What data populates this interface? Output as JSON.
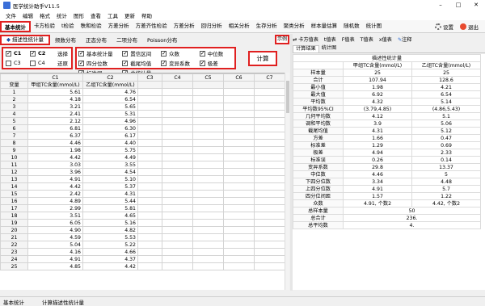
{
  "app": {
    "title": "医学统计助手V11.5"
  },
  "menu": [
    "文件",
    "编辑",
    "格式",
    "统计",
    "图形",
    "查看",
    "工具",
    "更新",
    "帮助"
  ],
  "ribbon": {
    "tabs": [
      "基本统计",
      "卡方检验",
      "t检验",
      "秩和检验",
      "方差分析",
      "方差齐性检验",
      "方差分析",
      "回归分析",
      "相关分析",
      "生存分析",
      "聚类分析",
      "样本量估算",
      "随机数",
      "统计图"
    ],
    "settings": "设置",
    "exit": "退出"
  },
  "subtabs": [
    "描述性统计量",
    "频数分布",
    "正态分布",
    "二项分布",
    "Poisson分布"
  ],
  "sample_label": "示例",
  "select_panel": {
    "rows": [
      {
        "a": "C1",
        "a_checked": true,
        "b": "C2",
        "b_checked": true,
        "action": "选择"
      },
      {
        "a": "C3",
        "a_checked": false,
        "b": "C4",
        "b_checked": false,
        "action": "还原"
      }
    ]
  },
  "options": [
    {
      "label": "基本统计量",
      "checked": true
    },
    {
      "label": "置信区间",
      "checked": true
    },
    {
      "label": "众数",
      "checked": true
    },
    {
      "label": "中位数",
      "checked": true
    },
    {
      "label": "四分位数",
      "checked": true
    },
    {
      "label": "截尾均值",
      "checked": true
    },
    {
      "label": "变异系数",
      "checked": true
    },
    {
      "label": "极差",
      "checked": true
    },
    {
      "label": "标准误",
      "checked": true
    },
    {
      "label": "总统计量",
      "checked": true
    }
  ],
  "calc_label": "计算",
  "grid": {
    "col_headers": [
      "",
      "C1",
      "C2",
      "C3",
      "C4",
      "C5",
      "C6",
      "C7"
    ],
    "var_label": "变量",
    "var_names": [
      "甲组TC含量(mmol/L)",
      "乙组TC含量(mmol/L)"
    ],
    "rows": [
      [
        "1",
        "5.61",
        "4.76"
      ],
      [
        "2",
        "4.18",
        "6.54"
      ],
      [
        "3",
        "3.21",
        "5.65"
      ],
      [
        "4",
        "2.41",
        "5.31"
      ],
      [
        "5",
        "2.12",
        "4.96"
      ],
      [
        "6",
        "6.81",
        "6.30"
      ],
      [
        "7",
        "6.37",
        "6.17"
      ],
      [
        "8",
        "4.46",
        "4.40"
      ],
      [
        "9",
        "1.98",
        "5.75"
      ],
      [
        "10",
        "4.42",
        "4.49"
      ],
      [
        "11",
        "3.03",
        "3.55"
      ],
      [
        "12",
        "3.96",
        "4.54"
      ],
      [
        "13",
        "4.91",
        "5.10"
      ],
      [
        "14",
        "4.42",
        "5.37"
      ],
      [
        "15",
        "2.42",
        "4.31"
      ],
      [
        "16",
        "4.89",
        "5.44"
      ],
      [
        "17",
        "2.99",
        "5.81"
      ],
      [
        "18",
        "3.51",
        "4.65"
      ],
      [
        "19",
        "6.05",
        "5.16"
      ],
      [
        "20",
        "4.90",
        "4.82"
      ],
      [
        "21",
        "4.59",
        "5.53"
      ],
      [
        "22",
        "5.04",
        "5.22"
      ],
      [
        "23",
        "4.16",
        "4.66"
      ],
      [
        "24",
        "4.91",
        "4.37"
      ],
      [
        "25",
        "4.85",
        "4.42"
      ]
    ]
  },
  "right_toolbar": [
    "卡方值表",
    "t值表",
    "F值表",
    "T值表",
    "x值表",
    "注释"
  ],
  "result_tabs": [
    "计算结果",
    "统计图"
  ],
  "results": {
    "title": "描述性统计量",
    "headers": [
      "",
      "甲组TC含量(mmol/L)",
      "乙组TC含量(mmol/L)"
    ],
    "rows": [
      [
        "样本量",
        "25",
        "25"
      ],
      [
        "合计",
        "107.94",
        "128.6"
      ],
      [
        "最小值",
        "1.98",
        "4.21"
      ],
      [
        "最大值",
        "6.92",
        "6.54"
      ],
      [
        "平均数",
        "4.32",
        "5.14"
      ],
      [
        "平均数95%CI",
        "(3.79,4.85)",
        "(4.86,5.43)"
      ],
      [
        "几何平均数",
        "4.12",
        "5.1"
      ],
      [
        "调和平均数",
        "3.9",
        "5.06"
      ],
      [
        "截尾均值",
        "4.31",
        "5.12"
      ],
      [
        "方差",
        "1.66",
        "0.47"
      ],
      [
        "标准差",
        "1.29",
        "0.69"
      ],
      [
        "极差",
        "4.94",
        "2.33"
      ],
      [
        "标准误",
        "0.26",
        "0.14"
      ],
      [
        "变异系数",
        "29.8",
        "13.37"
      ],
      [
        "中位数",
        "4.46",
        "5"
      ],
      [
        "下四分位数",
        "3.34",
        "4.48"
      ],
      [
        "上四分位数",
        "4.91",
        "5.7"
      ],
      [
        "四分位间距",
        "1.57",
        "1.22"
      ],
      [
        "众数",
        "4.91, 个数2",
        "4.42, 个数2"
      ]
    ],
    "totals": [
      [
        "总样本量",
        "50"
      ],
      [
        "总合计",
        "236."
      ],
      [
        "总平均数",
        "4."
      ]
    ]
  },
  "status": [
    "基本统计",
    "计算描述性统计量"
  ]
}
